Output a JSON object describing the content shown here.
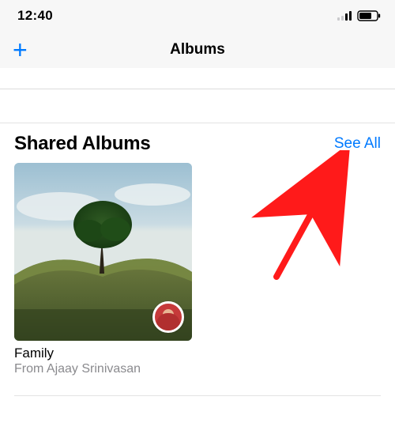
{
  "status": {
    "time": "12:40"
  },
  "nav": {
    "title": "Albums",
    "add_glyph": "+"
  },
  "section": {
    "title": "Shared Albums",
    "see_all": "See All"
  },
  "albums": [
    {
      "title": "Family",
      "subtitle": "From Ajaay Srinivasan"
    }
  ]
}
